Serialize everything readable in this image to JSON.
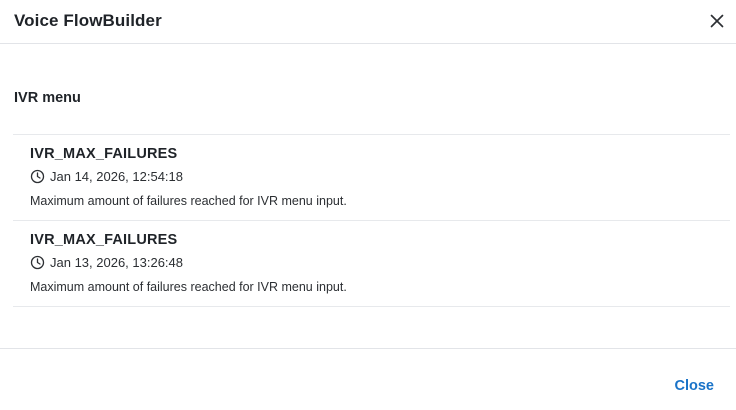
{
  "dialog": {
    "title": "Voice FlowBuilder",
    "close_icon": "close-icon"
  },
  "section": {
    "title": "IVR menu"
  },
  "items": [
    {
      "title": "IVR_MAX_FAILURES",
      "icon": "clock-icon",
      "timestamp": "Jan 14, 2026, 12:54:18",
      "description": "Maximum amount of failures reached for IVR menu input."
    },
    {
      "title": "IVR_MAX_FAILURES",
      "icon": "clock-icon",
      "timestamp": "Jan 13, 2026, 13:26:48",
      "description": "Maximum amount of failures reached for IVR menu input."
    }
  ],
  "footer": {
    "close_label": "Close"
  },
  "colors": {
    "accent": "#1a73c8",
    "divider": "#e2e4e8",
    "text": "#1f2328"
  }
}
